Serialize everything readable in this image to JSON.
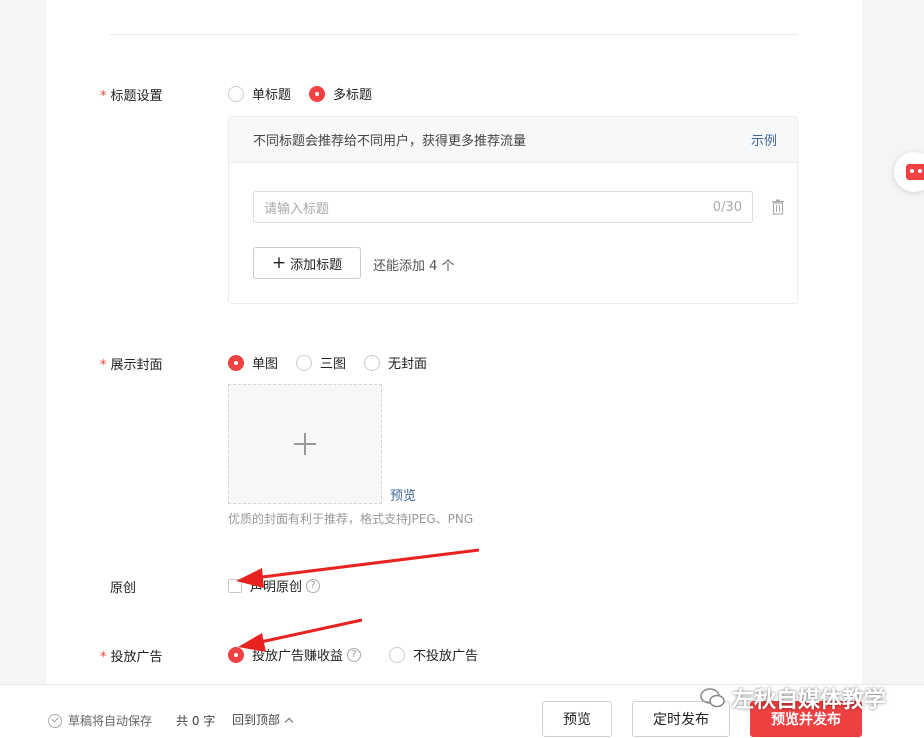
{
  "title_settings": {
    "label": "标题设置",
    "options": [
      "单标题",
      "多标题"
    ],
    "selected": "多标题",
    "hint": "不同标题会推荐给不同用户，获得更多推荐流量",
    "example_link": "示例",
    "input_placeholder": "请输入标题",
    "char_count": "0/30",
    "add_button": "添加标题",
    "add_tip": "还能添加 4 个"
  },
  "cover": {
    "label": "展示封面",
    "options": [
      "单图",
      "三图",
      "无封面"
    ],
    "selected": "单图",
    "preview_link": "预览",
    "tip": "优质的封面有利于推荐，格式支持JPEG、PNG"
  },
  "original": {
    "label": "原创",
    "checkbox_label": "声明原创",
    "checked": false
  },
  "ads": {
    "label": "投放广告",
    "options": [
      "投放广告赚收益",
      "不投放广告"
    ],
    "selected": "投放广告赚收益"
  },
  "footer": {
    "autosave": "草稿将自动保存",
    "word_count": "共 0 字",
    "back_to_top": "回到顶部",
    "preview_button": "预览",
    "schedule_button": "定时发布",
    "publish_button": "预览并发布"
  },
  "watermark": "左秋自媒体教学",
  "colors": {
    "accent": "#f04142",
    "link": "#406599",
    "annotation_arrow": "#e8231f"
  },
  "icons": {
    "required": "asterisk",
    "trash": "trash-icon",
    "help": "question-circle-icon",
    "autosave": "check-circle-icon",
    "back_top": "chevron-up-icon",
    "floating": "robot-assistant-icon",
    "watermark": "wechat-icon"
  }
}
